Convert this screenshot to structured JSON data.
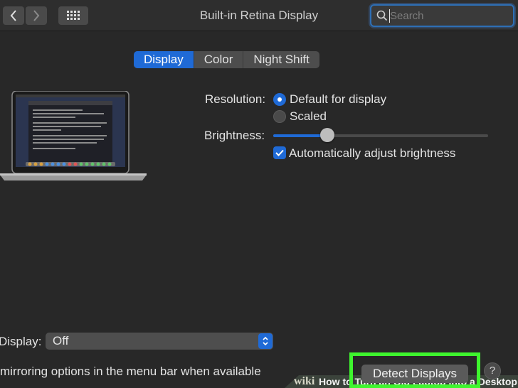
{
  "window": {
    "title": "Built-in Retina Display",
    "search_placeholder": "Search"
  },
  "tabs": [
    {
      "label": "Display",
      "active": true
    },
    {
      "label": "Color",
      "active": false
    },
    {
      "label": "Night Shift",
      "active": false
    }
  ],
  "settings": {
    "resolution_label": "Resolution:",
    "resolution_options": [
      {
        "label": "Default for display",
        "selected": true
      },
      {
        "label": "Scaled",
        "selected": false
      }
    ],
    "brightness_label": "Brightness:",
    "brightness_level": 0.25,
    "auto_brightness_label": "Automatically adjust brightness",
    "auto_brightness_checked": true
  },
  "airplay": {
    "label": "Display:",
    "value": "Off"
  },
  "mirroring_label": "mirroring options in the menu bar when available",
  "detect_displays_label": "Detect Displays",
  "help_label": "?",
  "watermark": {
    "logo": "wiki",
    "title": "How to Turn an Old Laptop into a Desktop"
  },
  "colors": {
    "accent": "#1f6ad6",
    "highlight_box": "#3ef52e"
  },
  "icons": [
    "chevron-left-icon",
    "chevron-right-icon",
    "grid-icon",
    "search-icon",
    "laptop-illustration",
    "check-icon",
    "updown-arrows-icon"
  ]
}
